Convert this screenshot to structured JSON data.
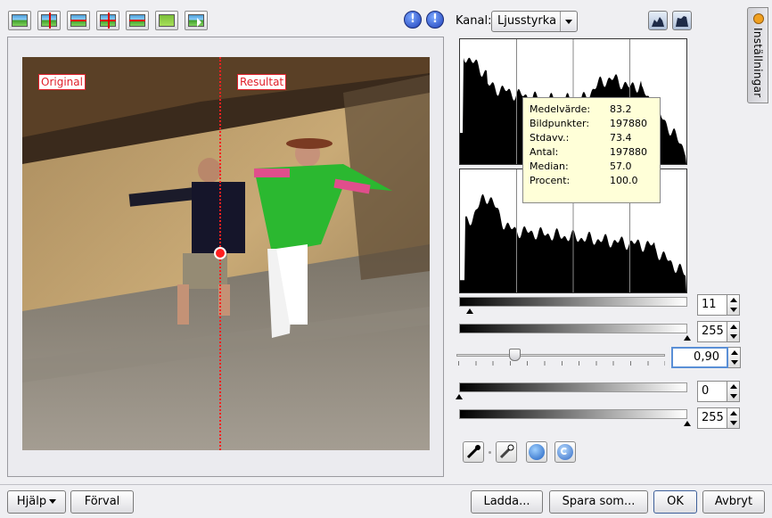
{
  "preview": {
    "label_original": "Original",
    "label_result": "Resultat"
  },
  "channel": {
    "label": "Kanal:",
    "selected": "Ljusstyrka"
  },
  "stats": {
    "rows": [
      {
        "key": "Medelvärde:",
        "value": "83.2"
      },
      {
        "key": "Bildpunkter:",
        "value": "197880"
      },
      {
        "key": "Stdavv.:",
        "value": "73.4"
      },
      {
        "key": "Antal:",
        "value": "197880"
      },
      {
        "key": "Median:",
        "value": "57.0"
      },
      {
        "key": "Procent:",
        "value": "100.0"
      }
    ]
  },
  "levels": {
    "input_low": "11",
    "input_high": "255",
    "gamma": "0,90",
    "output_low": "0",
    "output_high": "255"
  },
  "side_tab": {
    "label": "Inställningar"
  },
  "buttons": {
    "help": "Hjälp",
    "defaults": "Förval",
    "load": "Ladda...",
    "save_as": "Spara som...",
    "ok": "OK",
    "cancel": "Avbryt"
  },
  "icons": {
    "toolbar": [
      "single-preview-icon",
      "split-vertical-icon",
      "split-horizontal-icon",
      "split-cross-icon",
      "split-cross-alt-icon",
      "result-only-icon",
      "pick-cursor-icon"
    ],
    "info": [
      "info-icon",
      "info-icon"
    ],
    "histogram_scale": [
      "linear-histogram-icon",
      "log-histogram-icon"
    ],
    "tools": [
      "black-point-picker-icon",
      "white-point-picker-icon",
      "auto-adjust-icon",
      "reset-icon"
    ]
  },
  "colors": {
    "split_line": "#ff2020",
    "label_red": "#e0202a",
    "tooltip_bg": "#ffffd8"
  }
}
